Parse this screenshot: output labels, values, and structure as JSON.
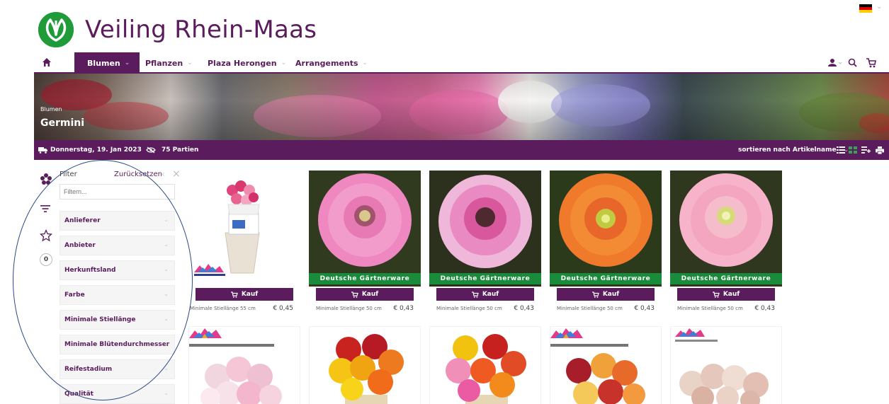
{
  "brand": {
    "name": "Veiling Rhein-Maas"
  },
  "colors": {
    "primary": "#5a1c5c",
    "green": "#1a8a3b",
    "logo_green": "#1f9b39"
  },
  "nav": {
    "items": [
      {
        "label": "Blumen",
        "active": true
      },
      {
        "label": "Pflanzen",
        "active": false
      },
      {
        "label": "Plaza Herongen",
        "active": false
      },
      {
        "label": "Arrangements",
        "active": false
      }
    ],
    "right_icons": [
      "user-icon",
      "search-icon",
      "cart-icon"
    ]
  },
  "banner": {
    "breadcrumb": "Blumen",
    "title": "Germini"
  },
  "toolbar": {
    "date": "Donnerstag, 19. Jan 2023",
    "lots": "75 Partien",
    "sort": "sortieren nach Artikelname"
  },
  "filter": {
    "title": "Filter",
    "reset": "Zurücksetzen",
    "search_placeholder": "Filtern...",
    "favorites_count": "0",
    "facets": [
      "Anlieferer",
      "Anbieter",
      "Herkunftsland",
      "Farbe",
      "Minimale Stiellänge",
      "Minimale Blütendurchmesser",
      "Reifestadium",
      "Qualität"
    ]
  },
  "products": [
    {
      "stem": "Minimale Stiellänge 55 cm",
      "price": "€ 0,45",
      "tag": "",
      "buy": "Kauf"
    },
    {
      "stem": "Minimale Stiellänge 50 cm",
      "price": "€ 0,43",
      "tag": "Deutsche Gärtnerware",
      "buy": "Kauf"
    },
    {
      "stem": "Minimale Stiellänge 50 cm",
      "price": "€ 0,43",
      "tag": "Deutsche Gärtnerware",
      "buy": "Kauf"
    },
    {
      "stem": "Minimale Stiellänge 50 cm",
      "price": "€ 0,43",
      "tag": "Deutsche Gärtnerware",
      "buy": "Kauf"
    },
    {
      "stem": "Minimale Stiellänge 50 cm",
      "price": "€ 0,43",
      "tag": "Deutsche Gärtnerware",
      "buy": "Kauf"
    }
  ]
}
